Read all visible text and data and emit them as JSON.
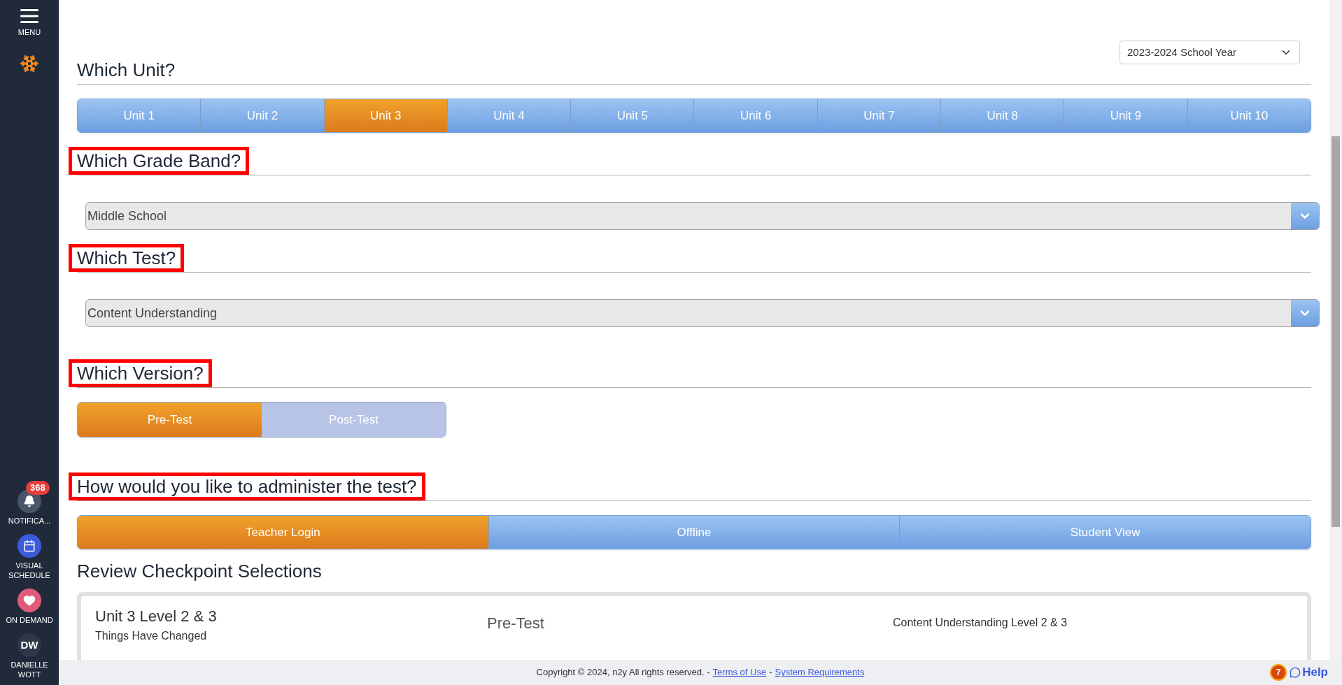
{
  "sidebar": {
    "menu_label": "MENU",
    "items": [
      {
        "kind": "notifications",
        "label": "NOTIFICA...",
        "badge": "368"
      },
      {
        "kind": "schedule",
        "label": "VISUAL SCHEDULE"
      },
      {
        "kind": "favorites",
        "label": "ON DEMAND"
      },
      {
        "kind": "avatar",
        "initials": "DW",
        "label": "DANIELLE WOTT"
      }
    ]
  },
  "school_year": {
    "value": "2023-2024 School Year"
  },
  "sections": [
    {
      "kind": "tabs",
      "heading": "Which Unit?",
      "highlighted": false,
      "options": [
        {
          "label": "Unit 1",
          "selected": false
        },
        {
          "label": "Unit 2",
          "selected": false
        },
        {
          "label": "Unit 3",
          "selected": true
        },
        {
          "label": "Unit 4",
          "selected": false
        },
        {
          "label": "Unit 5",
          "selected": false
        },
        {
          "label": "Unit 6",
          "selected": false
        },
        {
          "label": "Unit 7",
          "selected": false
        },
        {
          "label": "Unit 8",
          "selected": false
        },
        {
          "label": "Unit 9",
          "selected": false
        },
        {
          "label": "Unit 10",
          "selected": false
        }
      ]
    },
    {
      "kind": "select",
      "heading": "Which Grade Band?",
      "highlighted": true,
      "value": "Middle School"
    },
    {
      "kind": "select",
      "heading": "Which Test?",
      "highlighted": true,
      "value": "Content Understanding"
    },
    {
      "kind": "toggle",
      "heading": "Which Version?",
      "highlighted": true,
      "options": [
        {
          "label": "Pre-Test",
          "selected": true
        },
        {
          "label": "Post-Test",
          "selected": false
        }
      ]
    },
    {
      "kind": "tabs",
      "heading": "How would you like to administer the test?",
      "highlighted": true,
      "options": [
        {
          "label": "Teacher Login",
          "selected": true
        },
        {
          "label": "Offline",
          "selected": false
        },
        {
          "label": "Student View",
          "selected": false
        }
      ]
    }
  ],
  "review": {
    "heading": "Review Checkpoint Selections",
    "title": "Unit 3 Level 2 & 3",
    "subtitle": "Things Have Changed",
    "version": "Pre-Test",
    "test": "Content Understanding Level 2 & 3"
  },
  "footer": {
    "text": "Copyright © 2024, n2y All rights reserved. -",
    "separator": "-",
    "links": [
      "Terms of Use",
      "System Requirements"
    ],
    "help_count": "7",
    "help_label": "Help"
  }
}
